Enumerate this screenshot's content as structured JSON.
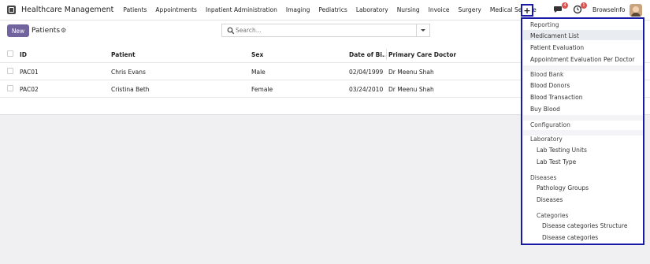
{
  "app": {
    "title": "Healthcare Management",
    "menu": [
      "Patients",
      "Appointments",
      "Inpatient Administration",
      "Imaging",
      "Pediatrics",
      "Laboratory",
      "Nursing",
      "Invoice",
      "Surgery",
      "Medical Service"
    ],
    "plus_label": "+",
    "chat_badge": "4",
    "activity_badge": "1",
    "company": "BrowseInfo"
  },
  "control": {
    "new_label": "New",
    "page_title": "Patients",
    "search_placeholder": "Search..."
  },
  "list": {
    "columns": [
      "ID",
      "Patient",
      "Sex",
      "Date of Bi...",
      "Primary Care Doctor"
    ],
    "rows": [
      [
        "PAC01",
        "Chris Evans",
        "Male",
        "02/04/1999",
        "Dr Meenu Shah"
      ],
      [
        "PAC02",
        "Cristina Beth",
        "Female",
        "03/24/2010",
        "Dr Meenu Shah"
      ]
    ]
  },
  "dropdown": {
    "reporting": "Reporting",
    "medicament_list": "Medicament List",
    "patient_evaluation": "Patient Evaluation",
    "appointment_evaluation": "Appointment Evaluation Per Doctor",
    "blood_bank": "Blood Bank",
    "blood_donors": "Blood Donors",
    "blood_transaction": "Blood Transaction",
    "buy_blood": "Buy Blood",
    "configuration": "Configuration",
    "laboratory": "Laboratory",
    "lab_testing_units": "Lab Testing Units",
    "lab_test_type": "Lab Test Type",
    "diseases_head": "Diseases",
    "pathology_groups": "Pathology Groups",
    "diseases": "Diseases",
    "categories": "Categories",
    "disease_categories_structure": "Disease categories Structure",
    "disease_categories": "Disease categories"
  },
  "colors": {
    "primary": "#71639e",
    "highlight_border": "#1a1aa8",
    "badge": "#d9534f"
  }
}
